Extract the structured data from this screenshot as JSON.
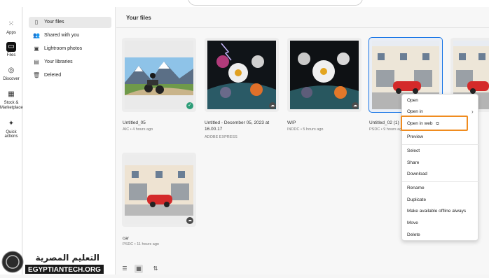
{
  "rail": [
    {
      "label": "Apps",
      "icon": "apps-grid-icon"
    },
    {
      "label": "Files",
      "icon": "folder-icon",
      "active": true
    },
    {
      "label": "Discover",
      "icon": "compass-icon"
    },
    {
      "label": "Stock & Marketplace",
      "icon": "stock-icon"
    },
    {
      "label": "Quick actions",
      "icon": "sparkle-icon"
    }
  ],
  "nav": [
    {
      "label": "Your files",
      "active": true
    },
    {
      "label": "Shared with you"
    },
    {
      "label": "Lightroom photos"
    },
    {
      "label": "Your libraries"
    },
    {
      "label": "Deleted"
    }
  ],
  "main": {
    "title": "Your files"
  },
  "files": [
    {
      "name": "Untitled_05",
      "meta": "AIC • 4 hours ago",
      "status": "synced"
    },
    {
      "name": "Untitled - December 05, 2023 at 16.00.17",
      "meta": "ADOBE EXPRESS",
      "status": "cloud"
    },
    {
      "name": "WIP",
      "meta": "INDDC • 5 hours ago",
      "status": "cloud"
    },
    {
      "name": "Untitled_02 (1)",
      "meta": "PSDC • 9 hours ago",
      "status": "cloud",
      "selected": true
    },
    {
      "name": "",
      "meta": "",
      "status": "cloud"
    },
    {
      "name": "car",
      "meta": "PSDC • 11 hours ago",
      "status": "cloud"
    }
  ],
  "context_menu": {
    "items": [
      "Open",
      "Open in",
      "Open in web",
      "Preview",
      "Select",
      "Share",
      "Download",
      "Rename",
      "Duplicate",
      "Make available offline always",
      "Move",
      "Delete"
    ],
    "highlighted": "Open in web"
  },
  "watermark": {
    "arabic": "التعليم المصرية",
    "latin": "EGYPTIANTECH.ORG"
  },
  "colors": {
    "accent": "#1473e6",
    "highlight": "#f08c1f",
    "synced": "#2d9d78"
  }
}
